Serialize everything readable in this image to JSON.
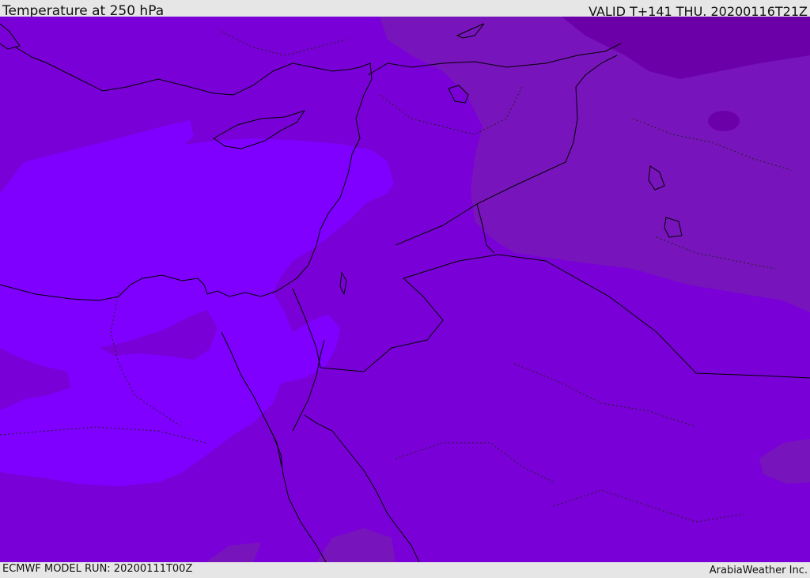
{
  "header": {
    "title": "Temperature at 250 hPa",
    "valid": "VALID T+141 THU. 20200116T21Z"
  },
  "footer": {
    "model_run": "ECMWF MODEL RUN: 20200111T00Z",
    "credit": "ArabiaWeather Inc."
  },
  "map": {
    "fill_colors": {
      "warmest": "#6c00a8",
      "warm": "#7814bb",
      "mid": "#7a00d8",
      "cool": "#7f00ff"
    }
  }
}
